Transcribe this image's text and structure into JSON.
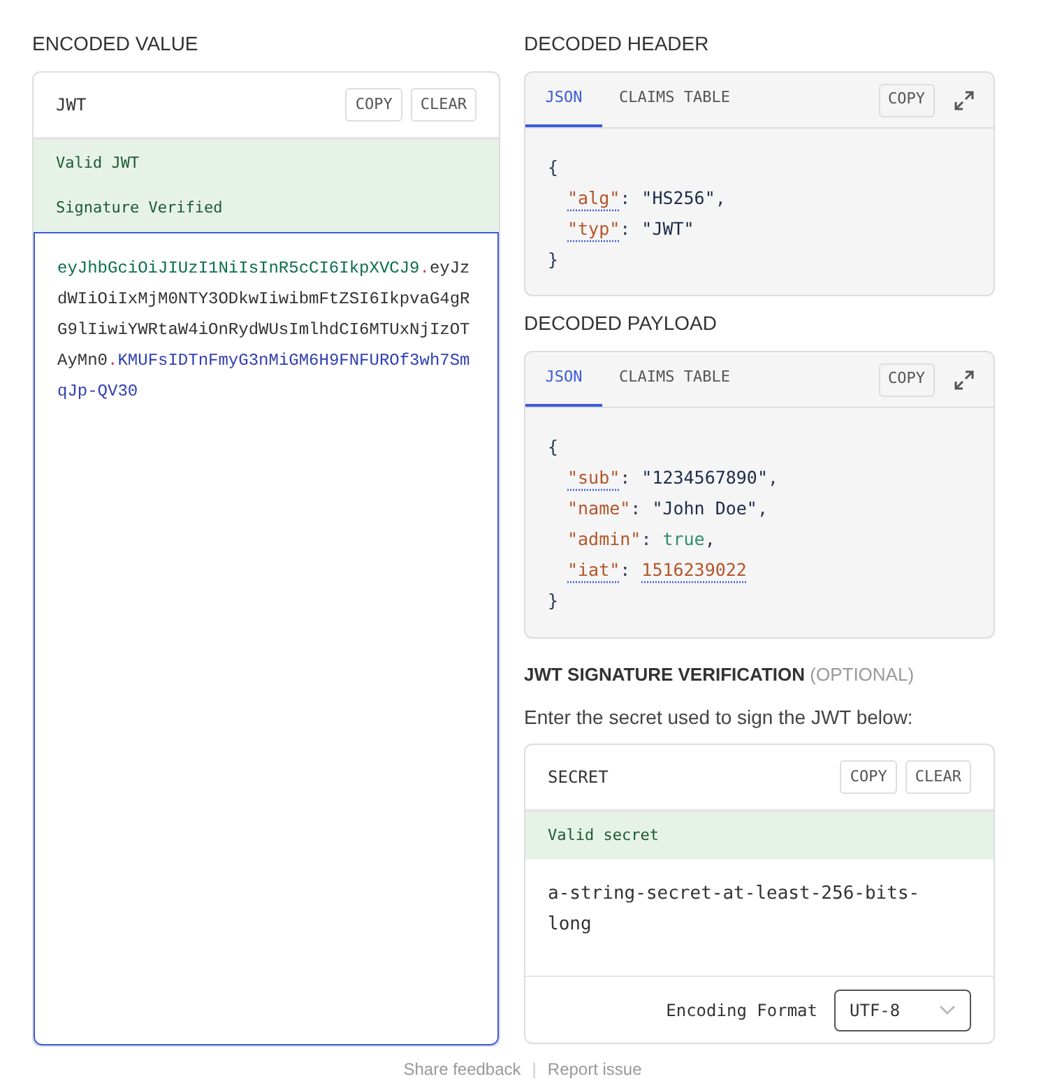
{
  "encoded": {
    "title": "ENCODED VALUE",
    "panel_label": "JWT",
    "buttons": [
      "COPY",
      "CLEAR"
    ],
    "status": [
      "Valid JWT",
      "Signature Verified"
    ],
    "token": [
      {
        "kind": "header",
        "text": "eyJhbGciOiJIUzI1NiIsInR5cCI6IkpXVCJ9"
      },
      {
        "kind": "dot",
        "text": "."
      },
      {
        "kind": "payload",
        "text": "eyJzdWIiOiIxMjM0NTY3ODkwIiwibmFtZSI6IkpvaG4gRG9lIiwiYWRtaW4iOnRydWUsImlhdCI6MTUxNjIzOTAyMn0"
      },
      {
        "kind": "dot",
        "text": "."
      },
      {
        "kind": "signature",
        "text": "KMUFsIDTnFmyG3nMiGM6H9FNFUROf3wh7SmqJp-QV30"
      }
    ]
  },
  "decoded_header": {
    "title": "DECODED HEADER",
    "tabs": [
      {
        "label": "JSON",
        "selected": true
      },
      {
        "label": "CLAIMS TABLE",
        "selected": false
      }
    ],
    "copy": "COPY",
    "open": "{",
    "close": "}",
    "lines": [
      {
        "key": "\"alg\"",
        "colon": ":",
        "value": "\"HS256\"",
        "kind": "string",
        "key_hint": true,
        "value_hint": false,
        "comma": ","
      },
      {
        "key": "\"typ\"",
        "colon": ":",
        "value": "\"JWT\"",
        "kind": "string",
        "key_hint": true,
        "value_hint": false
      }
    ]
  },
  "decoded_payload": {
    "title": "DECODED PAYLOAD",
    "tabs": [
      {
        "label": "JSON",
        "selected": true
      },
      {
        "label": "CLAIMS TABLE",
        "selected": false
      }
    ],
    "copy": "COPY",
    "open": "{",
    "close": "}",
    "lines": [
      {
        "key": "\"sub\"",
        "colon": ":",
        "value": "\"1234567890\"",
        "kind": "string",
        "key_hint": true,
        "value_hint": false,
        "comma": ","
      },
      {
        "key": "\"name\"",
        "colon": ":",
        "value": "\"John Doe\"",
        "kind": "string",
        "key_hint": false,
        "value_hint": false,
        "comma": ","
      },
      {
        "key": "\"admin\"",
        "colon": ":",
        "value": "true",
        "kind": "boolean",
        "key_hint": false,
        "value_hint": false,
        "comma": ","
      },
      {
        "key": "\"iat\"",
        "colon": ":",
        "value": "1516239022",
        "kind": "number",
        "key_hint": true,
        "value_hint": true
      }
    ]
  },
  "verification": {
    "title": "JWT SIGNATURE VERIFICATION",
    "title_note": "(OPTIONAL)",
    "subtitle": "Enter the secret used to sign the JWT below:",
    "panel_label": "SECRET",
    "buttons": [
      "COPY",
      "CLEAR"
    ],
    "status": "Valid secret",
    "secret": "a-string-secret-at-least-256-bits-long",
    "encoding_label": "Encoding Format",
    "encoding_value": "UTF-8"
  },
  "footer": [
    "Share feedback",
    "|",
    "Report issue"
  ]
}
